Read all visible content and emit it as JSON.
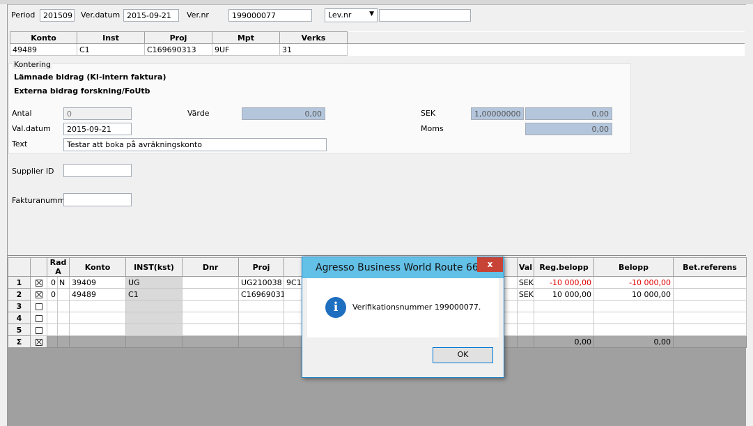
{
  "header": {
    "period_label": "Period",
    "period_value": "201509",
    "verdatum_label": "Ver.datum",
    "verdatum_value": "2015-09-21",
    "vernr_label": "Ver.nr",
    "vernr_value": "199000077",
    "levnr_select": "Lev.nr",
    "levnr_value": ""
  },
  "account_grid": {
    "columns": [
      "Konto",
      "Inst",
      "Proj",
      "Mpt",
      "Verks"
    ],
    "row": [
      "49489",
      "C1",
      "C169690313",
      "9UF",
      "31"
    ]
  },
  "kontering": {
    "group_label": "Kontering",
    "line1": "Lämnade bidrag (KI-intern faktura)",
    "line2": "Externa bidrag forskning/FoUtb",
    "antal_label": "Antal",
    "antal_value": "0",
    "varde_label": "Värde",
    "varde_value": "0,00",
    "sek_label": "SEK",
    "sek_rate": "1,00000000",
    "sek_value": "0,00",
    "valdatum_label": "Val.datum",
    "valdatum_value": "2015-09-21",
    "moms_label": "Moms",
    "moms_value": "0,00",
    "text_label": "Text",
    "text_value": "Testar att boka på avräkningskonto"
  },
  "extra": {
    "supplier_label": "Supplier ID",
    "supplier_value": "",
    "faktura_label": "Fakturanummer",
    "faktura_value": ""
  },
  "lines_grid": {
    "columns": [
      "Rad",
      "A",
      "Konto",
      "INST(kst)",
      "Dnr",
      "Proj",
      "Val",
      "Reg.belopp",
      "Belopp",
      "Bet.referens"
    ],
    "rows": [
      {
        "nr": "1",
        "checked": true,
        "rad": "0",
        "a": "N",
        "konto": "39409",
        "inst": "UG",
        "dnr": "",
        "proj": "UG210038",
        "extra": "9C1",
        "val": "SEK",
        "reg": "-10 000,00",
        "belopp": "-10 000,00",
        "ref": ""
      },
      {
        "nr": "2",
        "checked": true,
        "rad": "0",
        "a": "",
        "konto": "49489",
        "inst": "C1",
        "dnr": "",
        "proj": "C169690313",
        "extra": "",
        "val": "SEK",
        "reg": "10 000,00",
        "belopp": "10 000,00",
        "ref": ""
      },
      {
        "nr": "3",
        "checked": false
      },
      {
        "nr": "4",
        "checked": false
      },
      {
        "nr": "5",
        "checked": false
      }
    ],
    "sum_symbol": "Σ",
    "sum_reg": "0,00",
    "sum_belopp": "0,00"
  },
  "dialog": {
    "title": "Agresso Business World Route 66",
    "close": "x",
    "message": "Verifikationsnummer 199000077.",
    "ok_label": "OK",
    "info_glyph": "i"
  },
  "colors": {
    "dialog_title_bg": "#63c0e6",
    "close_bg": "#c74335",
    "info_icon": "#1f6fc0",
    "negative": "#e00000",
    "readonly_blue": "#b4c6dc"
  }
}
